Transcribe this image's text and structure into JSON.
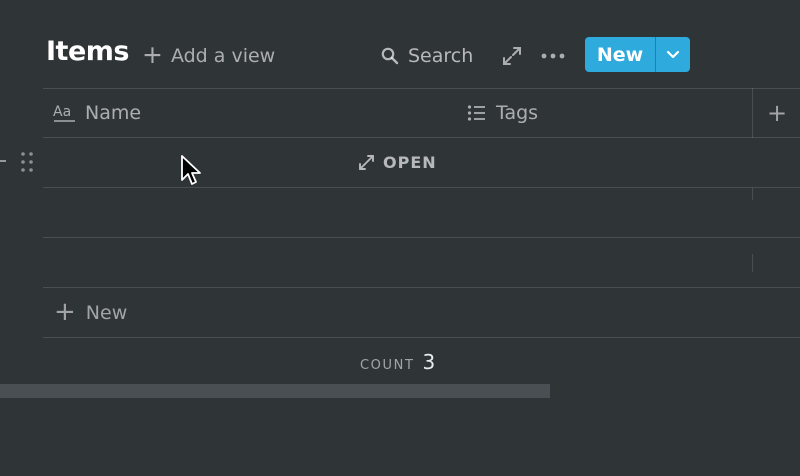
{
  "header": {
    "title": "Items",
    "add_view_label": "Add a view",
    "search_label": "Search",
    "new_button_label": "New"
  },
  "table": {
    "columns": [
      {
        "label": "Name",
        "icon": "text-property-icon"
      },
      {
        "label": "Tags",
        "icon": "list-property-icon"
      }
    ],
    "row_count": 3,
    "open_label": "OPEN",
    "new_row_label": "New",
    "count_label": "COUNT",
    "count_value": "3"
  },
  "colors": {
    "background": "#2f3437",
    "accent": "#2eaadc"
  }
}
